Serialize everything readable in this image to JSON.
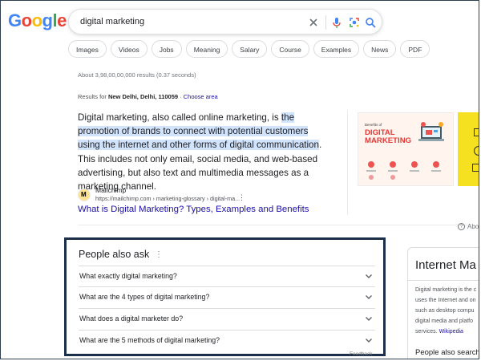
{
  "logo": {
    "text": "Google",
    "colors": [
      "#4285F4",
      "#EA4335",
      "#FBBC05",
      "#4285F4",
      "#34A853",
      "#EA4335"
    ]
  },
  "search": {
    "query": "digital marketing",
    "icons": [
      "close-icon",
      "mic-icon",
      "lens-icon",
      "search-icon"
    ]
  },
  "chips": [
    "Images",
    "Videos",
    "Jobs",
    "Meaning",
    "Salary",
    "Course",
    "Examples",
    "News",
    "PDF"
  ],
  "stats": "About 3,98,00,00,000 results (0.37 seconds)",
  "location": {
    "prefix": "Results for ",
    "place": "New Delhi, Delhi, 110059",
    "separator": " · ",
    "link": "Choose area"
  },
  "snippet": {
    "text_pre": "Digital marketing, also called online marketing, is ",
    "text_highlight": "the promotion of brands to connect with potential customers using the internet and other forms of digital communication",
    "text_post": ". This includes not only email, social media, and web-based advertising, but also text and multimedia messages as a marketing channel.",
    "source_name": "Mailchimp",
    "source_url": "https://mailchimp.com › marketing-glossary › digital-ma...",
    "link": "What is Digital Marketing? Types, Examples and Benefits",
    "image_text_small": "Benefits of",
    "image_text_line1": "DIGITAL",
    "image_text_line2": "MARKETING"
  },
  "about": "Abo",
  "paa": {
    "title": "People also ask",
    "questions": [
      "What exactly digital marketing?",
      "What are the 4 types of digital marketing?",
      "What does a digital marketer do?",
      "What are the 5 methods of digital marketing?"
    ],
    "feedback": "Feedback"
  },
  "knowledge_panel": {
    "title": "Internet Ma",
    "lines": [
      "Digital marketing is the c",
      "uses the Internet and on",
      "such as desktop compu",
      "digital media and platfo",
      "services. "
    ],
    "wiki": "Wikipedia",
    "people_also_search": "People also search"
  }
}
